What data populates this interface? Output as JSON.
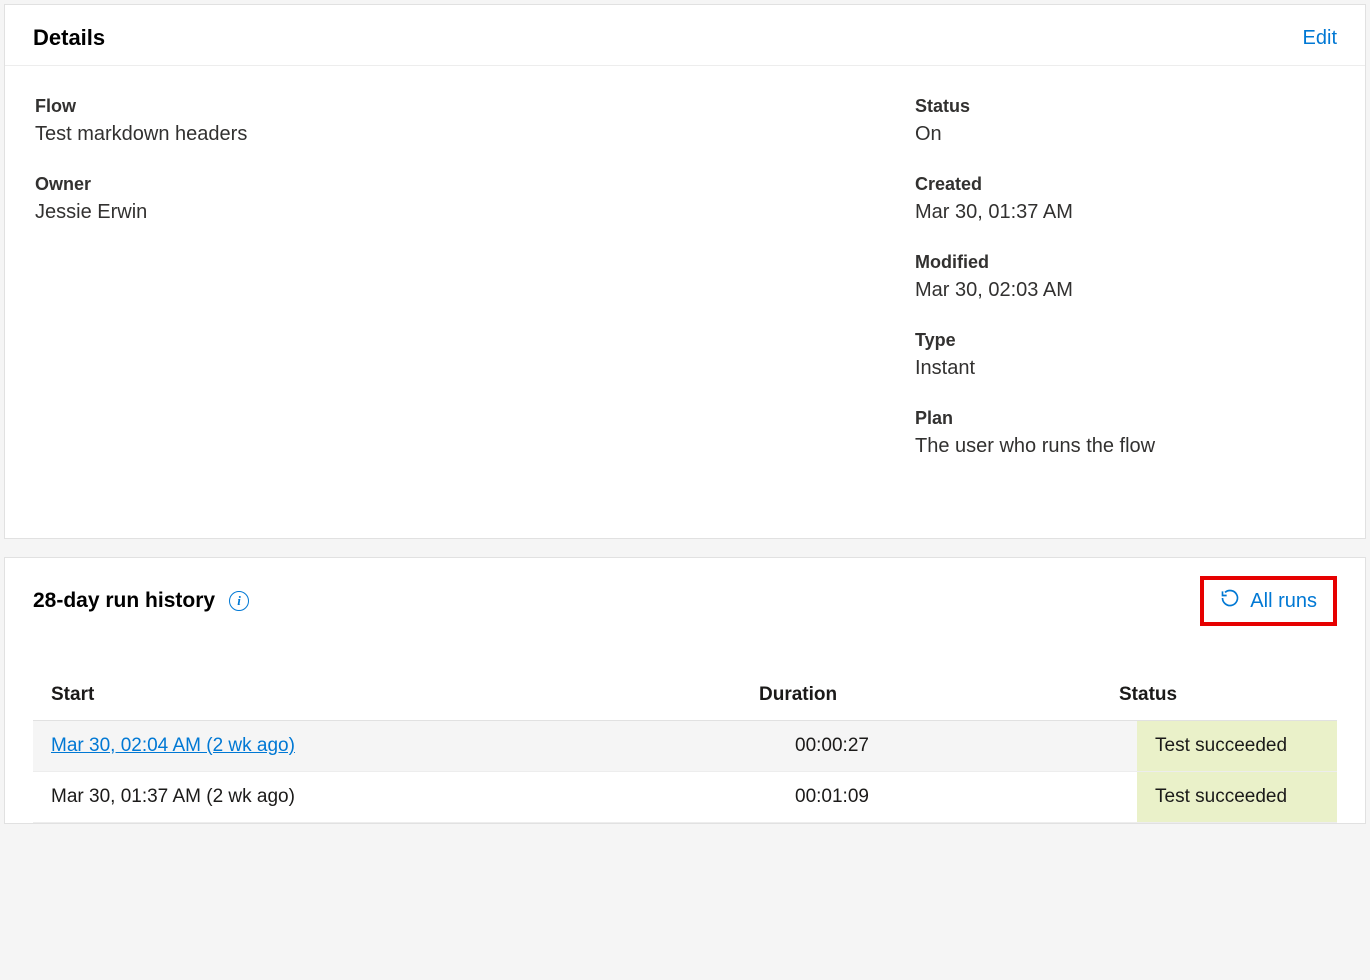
{
  "details": {
    "title": "Details",
    "edit": "Edit",
    "flow_label": "Flow",
    "flow_value": "Test markdown headers",
    "owner_label": "Owner",
    "owner_value": "Jessie Erwin",
    "status_label": "Status",
    "status_value": "On",
    "created_label": "Created",
    "created_value": "Mar 30, 01:37 AM",
    "modified_label": "Modified",
    "modified_value": "Mar 30, 02:03 AM",
    "type_label": "Type",
    "type_value": "Instant",
    "plan_label": "Plan",
    "plan_value": "The user who runs the flow"
  },
  "history": {
    "title": "28-day run history",
    "all_runs": "All runs",
    "columns": {
      "start": "Start",
      "duration": "Duration",
      "status": "Status"
    },
    "rows": [
      {
        "start": "Mar 30, 02:04 AM (2 wk ago)",
        "duration": "00:00:27",
        "status": "Test succeeded",
        "link": true,
        "hover": true
      },
      {
        "start": "Mar 30, 01:37 AM (2 wk ago)",
        "duration": "00:01:09",
        "status": "Test succeeded",
        "link": false,
        "hover": false
      }
    ]
  }
}
